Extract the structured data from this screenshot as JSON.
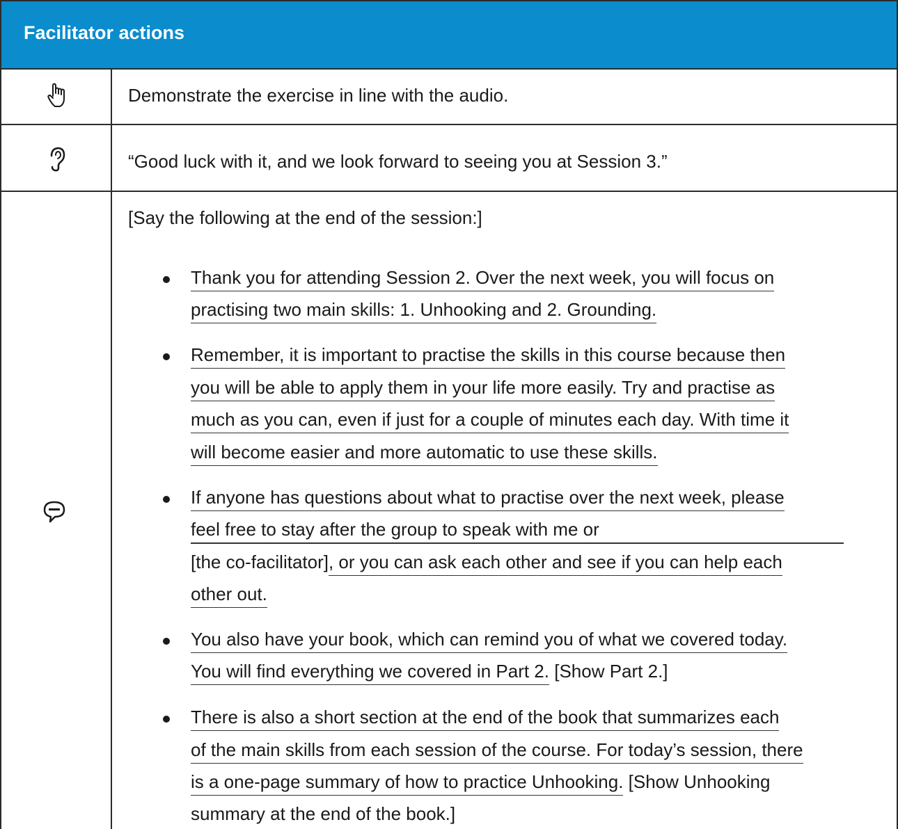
{
  "header": {
    "title": "Facilitator actions"
  },
  "icons": {
    "row1": "pointing-hand-icon",
    "row2": "ear-icon",
    "row3": "speech-bubble-icon"
  },
  "row1": {
    "text": "Demonstrate the exercise in line with the audio."
  },
  "row2": {
    "text": "“Good luck with it, and we look forward to seeing you at Session 3.”"
  },
  "row3": {
    "intro": "[Say the following at the end of the session:]",
    "bullets": [
      {
        "lines": [
          "Thank you for attending Session 2. Over the next week, you will focus on",
          "practising two main skills: 1. Unhooking and 2. Grounding."
        ]
      },
      {
        "lines": [
          "Remember, it is important to practise the skills in this course because then",
          "you will be able to apply them in your life more easily. Try and practise as",
          "much as you can, even if just for a couple of minutes each day. With time it",
          "will become easier and more automatic to use these skills."
        ]
      },
      {
        "lines": [
          "If anyone has questions about what to practise over the next week, please",
          "feel free to stay after the group to speak with me or",
          "[the co-facilitator]",
          ", or you can ask each other and see if you can help each",
          "other out."
        ]
      },
      {
        "lines": [
          "You also have your book, which can remind you of what we covered today.",
          "You will find everything we covered in Part 2.",
          " [Show Part 2.]"
        ]
      },
      {
        "lines": [
          "There is also a short section at the end of the book that summarizes each",
          "of the main skills from each session of the course. For today’s session, there",
          "is a one-page summary of how to practice Unhooking.",
          " [Show Unhooking",
          "summary at the end of the book.]"
        ]
      }
    ]
  }
}
